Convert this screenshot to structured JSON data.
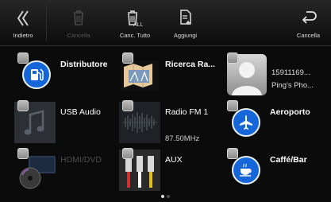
{
  "toolbar": {
    "back_label": "Indietro",
    "delete_label": "Cancella",
    "delete_all_label": "Canc. Tutto",
    "add_label": "Aggiungi",
    "cancel_label": "Cancella"
  },
  "tiles": {
    "distributore": "Distributore",
    "ricerca_rapida": "Ricerca Ra...",
    "contact_number": "15911169...",
    "contact_name": "Ping's Pho...",
    "usb_audio": "USB Audio",
    "radio_name": "Radio FM 1",
    "radio_freq": "87.50MHz",
    "aeroporto": "Aeroporto",
    "hdmi_dvd": "HDMI/DVD",
    "aux": "AUX",
    "caffe_bar": "Caffé/Bar"
  },
  "pager": {
    "pages": 2,
    "current": 1
  },
  "colors": {
    "accent_blue": "#1567d9",
    "background": "#0b0b0b",
    "checkbox": "#a8a8a8"
  },
  "icons": [
    "back-chevron-icon",
    "trash-icon",
    "trash-all-icon",
    "document-add-icon",
    "return-icon",
    "fuel-pump-icon",
    "map-thumbnail",
    "person-silhouette-icon",
    "music-note-icon",
    "radio-spectrum-icon",
    "airplane-icon",
    "dvd-disc-icon",
    "aux-rca-cable-icon",
    "coffee-cup-icon"
  ]
}
